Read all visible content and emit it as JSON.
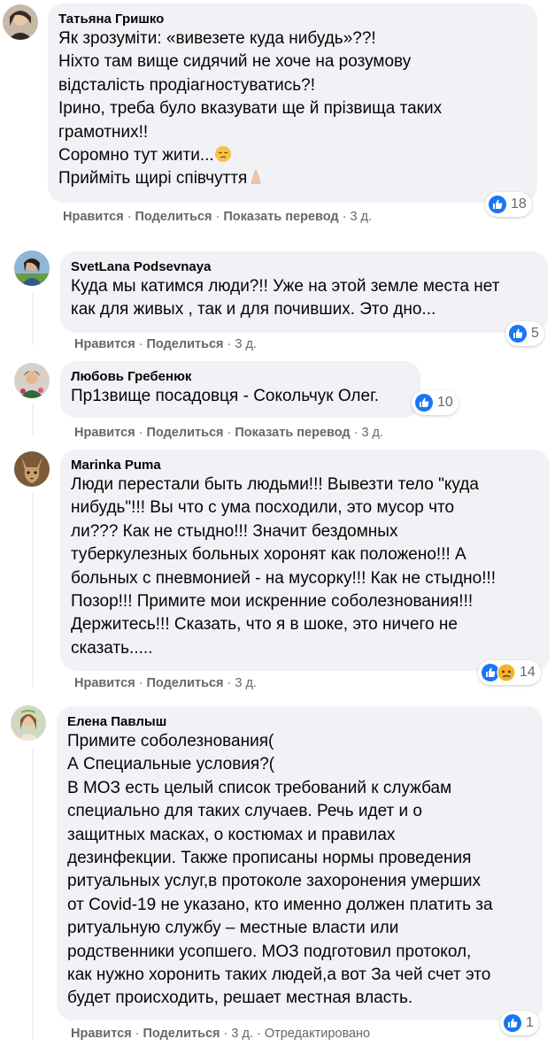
{
  "comments": [
    {
      "author": "Татьяна Гришко",
      "lines": [
        "Як зрозуміти: «вивезете куда нибудь»??!",
        "Ніхто там вище сидячий не хоче на розумову",
        "відсталість продіагностуватись?!",
        "Ірино, треба було вказувати ще й прізвища таких",
        "грамотних!!",
        "Соромно тут жити...",
        "Прийміть щирі співчуття"
      ],
      "actions": {
        "like": "Нравится",
        "share": "Поделиться",
        "translate": "Показать перевод",
        "time": "3 д."
      },
      "reactions": {
        "types": [
          "like-icon"
        ],
        "count": "18"
      }
    },
    {
      "author": "SvetLana Podsevnaya",
      "lines": [
        "Куда мы катимся люди?!! Уже на этой земле места нет",
        "как для живых , так и для почивших. Это дно..."
      ],
      "actions": {
        "like": "Нравится",
        "share": "Поделиться",
        "time": "3 д."
      },
      "reactions": {
        "types": [
          "like-icon"
        ],
        "count": "5"
      }
    },
    {
      "author": "Любовь Гребенюк",
      "lines": [
        "Пр1звище посадовця - Сокольчук Олег."
      ],
      "actions": {
        "like": "Нравится",
        "share": "Поделиться",
        "translate": "Показать перевод",
        "time": "3 д."
      },
      "reactions": {
        "types": [
          "like-icon"
        ],
        "count": "10"
      }
    },
    {
      "author": "Marinka Puma",
      "lines": [
        "Люди перестали быть людьми!!! Вывезти тело \"куда",
        "нибудь\"!!! Вы что с ума посходили, это мусор что",
        "ли??? Как не стыдно!!! Значит бездомных",
        "туберкулезных больных хоронят как положено!!! А",
        "больных с пневмонией - на мусорку!!! Как не стыдно!!!",
        "Позор!!! Примите мои искренние соболезнования!!!",
        "Держитесь!!! Сказать, что я в шоке, это ничего не",
        "сказать....."
      ],
      "actions": {
        "like": "Нравится",
        "share": "Поделиться",
        "time": "3 д."
      },
      "reactions": {
        "types": [
          "like-icon",
          "sad-icon"
        ],
        "count": "14"
      }
    },
    {
      "author": "Елена Павлыш",
      "lines": [
        "Примите соболезнования(",
        "А Специальные условия?(",
        "В МОЗ есть целый список требований к службам",
        "специально для таких случаев. Речь идет и о",
        "защитных масках, о костюмах и правилах",
        "дезинфекции. Также прописаны нормы проведения",
        "ритуальных услуг,в протоколе захоронения умерших",
        "от Covid-19 не указано, кто именно должен платить за",
        "ритуальную службу – местные власти или",
        "родственники усопшего. МОЗ подготовил протокол,",
        "как нужно хоронить таких людей,а вот За чей счет это",
        "будет происходить, решает местная власть."
      ],
      "actions": {
        "like": "Нравится",
        "share": "Поделиться",
        "time": "3 д.",
        "edited": "Отредактировано"
      },
      "reactions": {
        "types": [
          "like-icon"
        ],
        "count": "1"
      }
    }
  ],
  "colors": {
    "bubble": "#f0f2f5",
    "text": "#050505",
    "secondary": "#65676b",
    "like_blue": "#1877f2",
    "sad_yellow": "#f7b125"
  }
}
